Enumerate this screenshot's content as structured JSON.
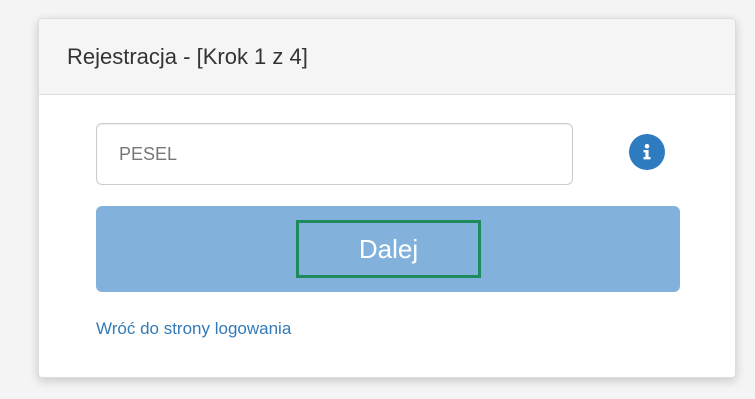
{
  "panel": {
    "title": "Rejestracja - [Krok 1 z 4]"
  },
  "form": {
    "pesel": {
      "placeholder": "PESEL",
      "value": ""
    },
    "info_icon": "info-circle-icon",
    "next_label": "Dalej",
    "back_link_label": "Wróć do strony logowania"
  },
  "colors": {
    "button": "#82b2dc",
    "info_icon": "#2f7bbf",
    "link": "#337ab7",
    "highlight_border": "#1e8a5e"
  }
}
